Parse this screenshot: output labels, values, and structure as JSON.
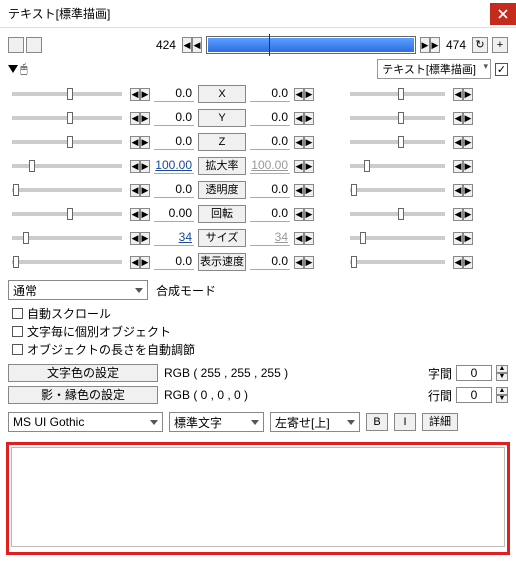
{
  "window": {
    "title": "テキスト[標準描画]"
  },
  "playback": {
    "left": "424",
    "right": "474",
    "fill_pct": 100,
    "tick_pct": 30
  },
  "tag": {
    "label": "テキスト[標準描画]",
    "checked": true
  },
  "params": [
    {
      "label": "X",
      "left": "0.0",
      "right": "0.0",
      "lpos": 50,
      "rpos": 50,
      "link": false
    },
    {
      "label": "Y",
      "left": "0.0",
      "right": "0.0",
      "lpos": 50,
      "rpos": 50,
      "link": false
    },
    {
      "label": "Z",
      "left": "0.0",
      "right": "0.0",
      "lpos": 50,
      "rpos": 50,
      "link": false
    },
    {
      "label": "拡大率",
      "left": "100.00",
      "right": "100.00",
      "lpos": 15,
      "rpos": 15,
      "link": true
    },
    {
      "label": "透明度",
      "left": "0.0",
      "right": "0.0",
      "lpos": 1,
      "rpos": 1,
      "link": false
    },
    {
      "label": "回転",
      "left": "0.00",
      "right": "0.0",
      "lpos": 50,
      "rpos": 50,
      "link": false
    },
    {
      "label": "サイズ",
      "left": "34",
      "right": "34",
      "lpos": 10,
      "rpos": 10,
      "link": true
    },
    {
      "label": "表示速度",
      "left": "0.0",
      "right": "0.0",
      "lpos": 1,
      "rpos": 1,
      "link": false
    }
  ],
  "mode": {
    "dropdown": "通常",
    "label": "合成モード"
  },
  "checks": [
    {
      "label": "自動スクロール"
    },
    {
      "label": "文字毎に個別オブジェクト"
    },
    {
      "label": "オブジェクトの長さを自動調節"
    }
  ],
  "color": {
    "text_btn": "文字色の設定",
    "text_rgb": "RGB ( 255 , 255 , 255 )",
    "shadow_btn": "影・縁色の設定",
    "shadow_rgb": "RGB ( 0 , 0 , 0 )",
    "char_spacing_label": "字間",
    "char_spacing": "0",
    "line_spacing_label": "行間",
    "line_spacing": "0"
  },
  "font": {
    "family": "MS UI Gothic",
    "style": "標準文字",
    "align": "左寄せ[上]",
    "b": "B",
    "i": "I",
    "detail": "詳細"
  },
  "textarea": ""
}
